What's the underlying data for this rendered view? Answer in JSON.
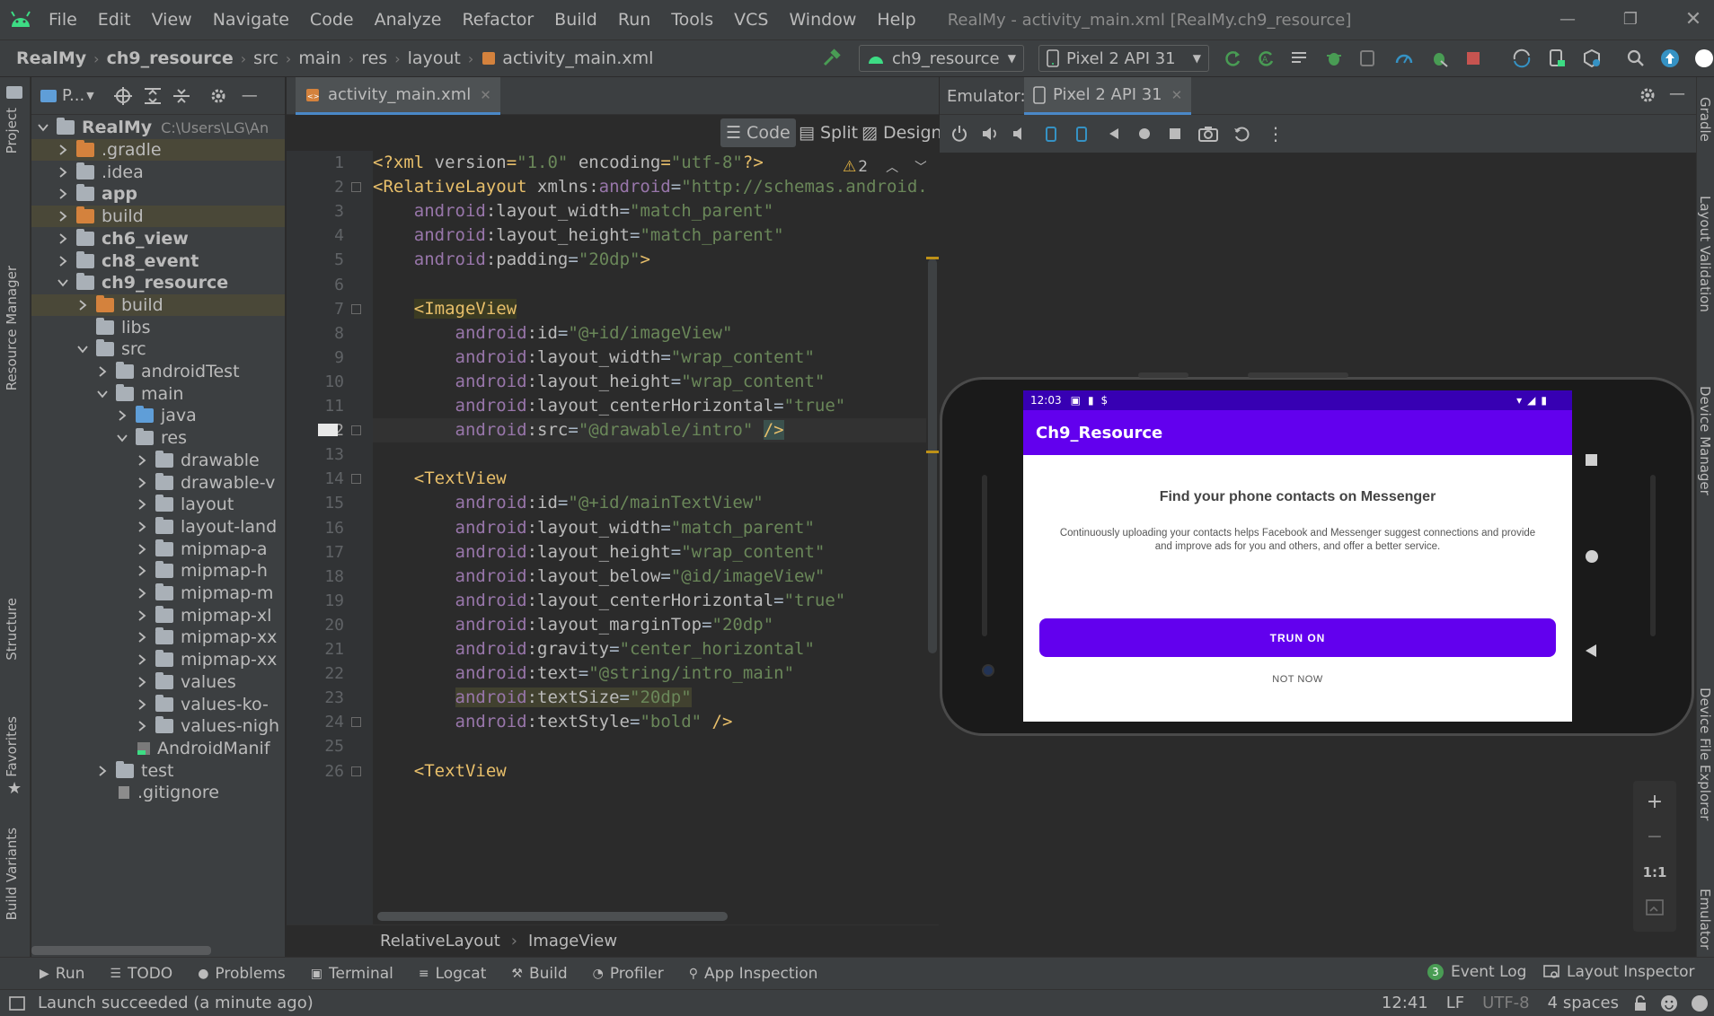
{
  "menu": {
    "items": [
      "File",
      "Edit",
      "View",
      "Navigate",
      "Code",
      "Analyze",
      "Refactor",
      "Build",
      "Run",
      "Tools",
      "VCS",
      "Window",
      "Help"
    ],
    "window_title": "RealMy - activity_main.xml [RealMy.ch9_resource]"
  },
  "nav": {
    "crumbs": [
      "RealMy",
      "ch9_resource",
      "src",
      "main",
      "res",
      "layout",
      "activity_main.xml"
    ],
    "config_combo": "ch9_resource",
    "device_combo": "Pixel 2 API 31"
  },
  "left_strip": {
    "tabs": [
      "Project",
      "Resource Manager",
      "Structure",
      "Favorites",
      "Build Variants"
    ]
  },
  "right_strip": {
    "tabs": [
      "Gradle",
      "Layout Validation",
      "Device Manager",
      "Device File Explorer",
      "Emulator"
    ]
  },
  "project": {
    "view_label": "P...",
    "tree": [
      {
        "label": "RealMy",
        "suffix": "C:\\Users\\LG\\An",
        "depth": 0,
        "folder": "grey",
        "arrow": "down",
        "bold": true
      },
      {
        "label": ".gradle",
        "depth": 1,
        "folder": "orange",
        "arrow": "right",
        "hl": true
      },
      {
        "label": ".idea",
        "depth": 1,
        "folder": "grey",
        "arrow": "right"
      },
      {
        "label": "app",
        "depth": 1,
        "folder": "grey",
        "arrow": "right",
        "bold": true
      },
      {
        "label": "build",
        "depth": 1,
        "folder": "orange",
        "arrow": "right",
        "hl": true
      },
      {
        "label": "ch6_view",
        "depth": 1,
        "folder": "grey",
        "arrow": "right",
        "bold": true
      },
      {
        "label": "ch8_event",
        "depth": 1,
        "folder": "grey",
        "arrow": "right",
        "bold": true
      },
      {
        "label": "ch9_resource",
        "depth": 1,
        "folder": "grey",
        "arrow": "down",
        "bold": true
      },
      {
        "label": "build",
        "depth": 2,
        "folder": "orange",
        "arrow": "right",
        "hl": true
      },
      {
        "label": "libs",
        "depth": 2,
        "folder": "grey",
        "arrow": "none"
      },
      {
        "label": "src",
        "depth": 2,
        "folder": "grey",
        "arrow": "down"
      },
      {
        "label": "androidTest",
        "depth": 3,
        "folder": "grey",
        "arrow": "right"
      },
      {
        "label": "main",
        "depth": 3,
        "folder": "grey",
        "arrow": "down"
      },
      {
        "label": "java",
        "depth": 4,
        "folder": "blue",
        "arrow": "right"
      },
      {
        "label": "res",
        "depth": 4,
        "folder": "grey",
        "arrow": "down"
      },
      {
        "label": "drawable",
        "depth": 5,
        "folder": "grey",
        "arrow": "right"
      },
      {
        "label": "drawable-v",
        "depth": 5,
        "folder": "grey",
        "arrow": "right"
      },
      {
        "label": "layout",
        "depth": 5,
        "folder": "grey",
        "arrow": "right"
      },
      {
        "label": "layout-land",
        "depth": 5,
        "folder": "grey",
        "arrow": "right"
      },
      {
        "label": "mipmap-a",
        "depth": 5,
        "folder": "grey",
        "arrow": "right"
      },
      {
        "label": "mipmap-h",
        "depth": 5,
        "folder": "grey",
        "arrow": "right"
      },
      {
        "label": "mipmap-m",
        "depth": 5,
        "folder": "grey",
        "arrow": "right"
      },
      {
        "label": "mipmap-xl",
        "depth": 5,
        "folder": "grey",
        "arrow": "right"
      },
      {
        "label": "mipmap-xx",
        "depth": 5,
        "folder": "grey",
        "arrow": "right"
      },
      {
        "label": "mipmap-xx",
        "depth": 5,
        "folder": "grey",
        "arrow": "right"
      },
      {
        "label": "values",
        "depth": 5,
        "folder": "grey",
        "arrow": "right"
      },
      {
        "label": "values-ko-",
        "depth": 5,
        "folder": "grey",
        "arrow": "right"
      },
      {
        "label": "values-nigh",
        "depth": 5,
        "folder": "grey",
        "arrow": "right"
      },
      {
        "label": "AndroidManif",
        "depth": 4,
        "folder": "file",
        "arrow": "none"
      },
      {
        "label": "test",
        "depth": 3,
        "folder": "grey",
        "arrow": "right"
      },
      {
        "label": ".gitignore",
        "depth": 3,
        "folder": "file2",
        "arrow": "none"
      }
    ]
  },
  "editor": {
    "tab_label": "activity_main.xml",
    "modes": [
      "Code",
      "Split",
      "Design"
    ],
    "warning_count": "2",
    "current_line": 12,
    "lines": [
      [
        [
          "pi",
          "<?xml "
        ],
        [
          "attr",
          "version"
        ],
        [
          "pi",
          "="
        ],
        [
          "str",
          "\"1.0\""
        ],
        [
          "pi",
          " "
        ],
        [
          "attr",
          "encoding"
        ],
        [
          "pi",
          "="
        ],
        [
          "str",
          "\"utf-8\""
        ],
        [
          "pi",
          "?>"
        ]
      ],
      [
        [
          "tag",
          "<RelativeLayout "
        ],
        [
          "attr",
          "xmlns:"
        ],
        [
          "ns",
          "android"
        ],
        [
          "plain",
          "="
        ],
        [
          "str",
          "\"http://schemas.android.com/apk/res/android\""
        ]
      ],
      [
        [
          "plain",
          "    "
        ],
        [
          "ns",
          "android"
        ],
        [
          "attr",
          ":layout_width"
        ],
        [
          "plain",
          "="
        ],
        [
          "str",
          "\"match_parent\""
        ]
      ],
      [
        [
          "plain",
          "    "
        ],
        [
          "ns",
          "android"
        ],
        [
          "attr",
          ":layout_height"
        ],
        [
          "plain",
          "="
        ],
        [
          "str",
          "\"match_parent\""
        ]
      ],
      [
        [
          "plain",
          "    "
        ],
        [
          "ns",
          "android"
        ],
        [
          "attr",
          ":padding"
        ],
        [
          "plain",
          "="
        ],
        [
          "str",
          "\"20dp\""
        ],
        [
          "tag",
          ">"
        ]
      ],
      [],
      [
        [
          "plain",
          "    "
        ],
        [
          "tag hl-tag",
          "<ImageView"
        ]
      ],
      [
        [
          "plain",
          "        "
        ],
        [
          "ns",
          "android"
        ],
        [
          "attr",
          ":id"
        ],
        [
          "plain",
          "="
        ],
        [
          "str",
          "\"@+id/imageView\""
        ]
      ],
      [
        [
          "plain",
          "        "
        ],
        [
          "ns",
          "android"
        ],
        [
          "attr",
          ":layout_width"
        ],
        [
          "plain",
          "="
        ],
        [
          "str",
          "\"wrap_content\""
        ]
      ],
      [
        [
          "plain",
          "        "
        ],
        [
          "ns",
          "android"
        ],
        [
          "attr",
          ":layout_height"
        ],
        [
          "plain",
          "="
        ],
        [
          "str",
          "\"wrap_content\""
        ]
      ],
      [
        [
          "plain",
          "        "
        ],
        [
          "ns",
          "android"
        ],
        [
          "attr",
          ":layout_centerHorizontal"
        ],
        [
          "plain",
          "="
        ],
        [
          "str",
          "\"true\""
        ]
      ],
      [
        [
          "plain",
          "        "
        ],
        [
          "ns",
          "android"
        ],
        [
          "attr",
          ":src"
        ],
        [
          "plain",
          "="
        ],
        [
          "str",
          "\"@drawable/intro\""
        ],
        [
          "plain",
          " "
        ],
        [
          "tag hl-brace",
          "/>"
        ]
      ],
      [],
      [
        [
          "plain",
          "    "
        ],
        [
          "tag",
          "<TextView"
        ]
      ],
      [
        [
          "plain",
          "        "
        ],
        [
          "ns",
          "android"
        ],
        [
          "attr",
          ":id"
        ],
        [
          "plain",
          "="
        ],
        [
          "str",
          "\"@+id/mainTextView\""
        ]
      ],
      [
        [
          "plain",
          "        "
        ],
        [
          "ns",
          "android"
        ],
        [
          "attr",
          ":layout_width"
        ],
        [
          "plain",
          "="
        ],
        [
          "str",
          "\"match_parent\""
        ]
      ],
      [
        [
          "plain",
          "        "
        ],
        [
          "ns",
          "android"
        ],
        [
          "attr",
          ":layout_height"
        ],
        [
          "plain",
          "="
        ],
        [
          "str",
          "\"wrap_content\""
        ]
      ],
      [
        [
          "plain",
          "        "
        ],
        [
          "ns",
          "android"
        ],
        [
          "attr",
          ":layout_below"
        ],
        [
          "plain",
          "="
        ],
        [
          "str",
          "\"@id/imageView\""
        ]
      ],
      [
        [
          "plain",
          "        "
        ],
        [
          "ns",
          "android"
        ],
        [
          "attr",
          ":layout_centerHorizontal"
        ],
        [
          "plain",
          "="
        ],
        [
          "str",
          "\"true\""
        ]
      ],
      [
        [
          "plain",
          "        "
        ],
        [
          "ns",
          "android"
        ],
        [
          "attr",
          ":layout_marginTop"
        ],
        [
          "plain",
          "="
        ],
        [
          "str",
          "\"20dp\""
        ]
      ],
      [
        [
          "plain",
          "        "
        ],
        [
          "ns",
          "android"
        ],
        [
          "attr",
          ":gravity"
        ],
        [
          "plain",
          "="
        ],
        [
          "str",
          "\"center_horizontal\""
        ]
      ],
      [
        [
          "plain",
          "        "
        ],
        [
          "ns",
          "android"
        ],
        [
          "attr",
          ":text"
        ],
        [
          "plain",
          "="
        ],
        [
          "str",
          "\"@string/intro_main\""
        ]
      ],
      [
        [
          "plain",
          "        "
        ],
        [
          "ns hl-attr",
          "android"
        ],
        [
          "attr hl-attr",
          ":textSize"
        ],
        [
          "plain hl-attr",
          "="
        ],
        [
          "str hl-attr",
          "\"20dp\""
        ]
      ],
      [
        [
          "plain",
          "        "
        ],
        [
          "ns",
          "android"
        ],
        [
          "attr",
          ":textStyle"
        ],
        [
          "plain",
          "="
        ],
        [
          "str",
          "\"bold\""
        ],
        [
          "plain",
          " "
        ],
        [
          "tag",
          "/>"
        ]
      ],
      [],
      [
        [
          "plain",
          "    "
        ],
        [
          "tag",
          "<TextView"
        ]
      ]
    ],
    "breadcrumb": [
      "RelativeLayout",
      "ImageView"
    ]
  },
  "emulator": {
    "label": "Emulator:",
    "device_tab": "Pixel 2 API 31",
    "screen": {
      "time": "12:03",
      "app_title": "Ch9_Resource",
      "heading": "Find your phone contacts on Messenger",
      "body": "Continuously uploading your contacts helps Facebook and Messenger suggest connections and provide and improve ads for you and others, and offer a better service.",
      "primary_button": "TRUN ON",
      "secondary_button": "NOT NOW"
    },
    "zoom": {
      "plus": "+",
      "minus": "−",
      "one_to_one": "1:1"
    }
  },
  "bottom_tools": {
    "left": [
      "Run",
      "TODO",
      "Problems",
      "Terminal",
      "Logcat",
      "Build",
      "Profiler",
      "App Inspection"
    ],
    "event_log": "Event Log",
    "event_count": "3",
    "layout_inspector": "Layout Inspector"
  },
  "status": {
    "message": "Launch succeeded (a minute ago)",
    "position": "12:41",
    "line_sep": "LF",
    "encoding": "UTF-8",
    "indent": "4 spaces"
  },
  "colors": {
    "accent_purple": "#6200ee",
    "status_purple": "#3700b3",
    "ide_panel": "#3c3f41",
    "editor_bg": "#2b2b2b"
  }
}
